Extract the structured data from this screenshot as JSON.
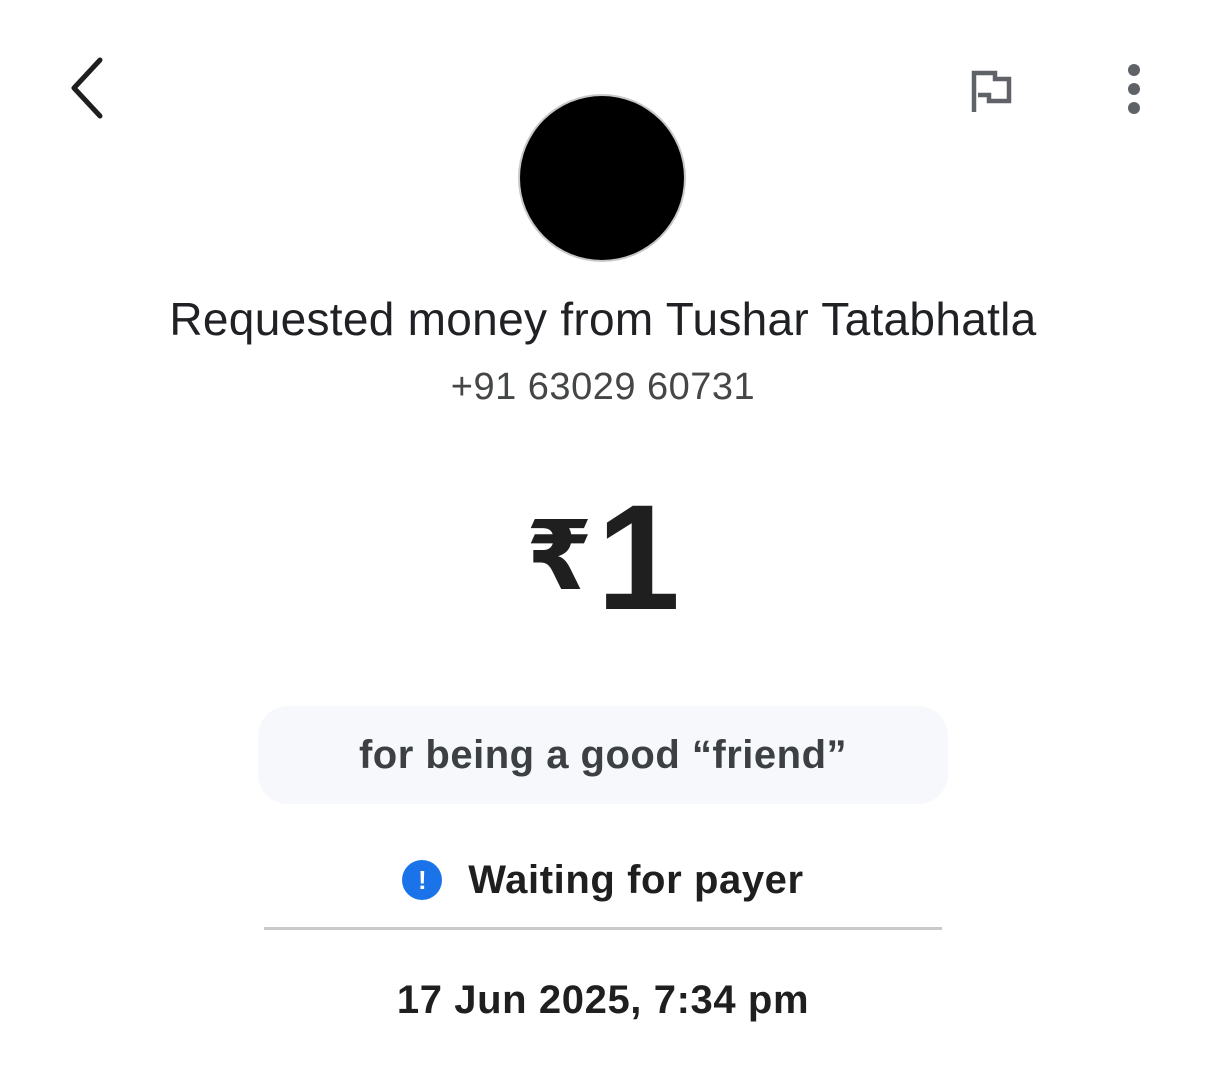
{
  "header": {
    "back_icon": "chevron-left-icon",
    "report_icon": "flag-icon",
    "more_icon": "more-vert-icon"
  },
  "request": {
    "title": "Requested money from Tushar Tatabhatla",
    "phone": "+91 63029 60731",
    "currency_symbol": "₹",
    "amount": "1",
    "note": "for being a good “friend”",
    "status": {
      "icon": "info-exclamation-icon",
      "icon_glyph": "!",
      "text": "Waiting for payer",
      "color": "#1a73e8"
    },
    "datetime": "17 Jun 2025, 7:34 pm"
  }
}
